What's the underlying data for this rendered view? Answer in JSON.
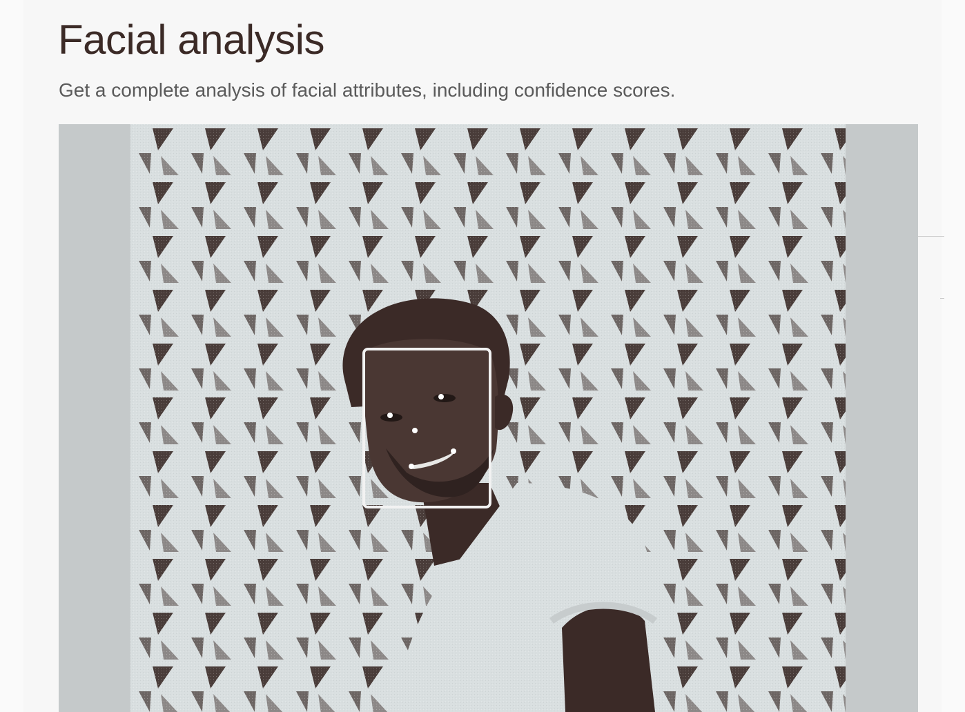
{
  "header": {
    "title": "Facial analysis",
    "subtitle": "Get a complete analysis of facial attributes, including confidence scores."
  },
  "photo": {
    "subject": "portrait-photo",
    "face_detected": true,
    "landmarks": [
      "left-eye",
      "right-eye",
      "nose",
      "mouth-left",
      "mouth-right"
    ]
  },
  "colors": {
    "title_text": "#3b2a26",
    "subtitle_text": "#5a5a5a",
    "frame_bg": "#c5c9ca",
    "wall": "#d9dfe0",
    "shadow_dark": "#3b2a27",
    "bounding_box": "#ffffff"
  }
}
